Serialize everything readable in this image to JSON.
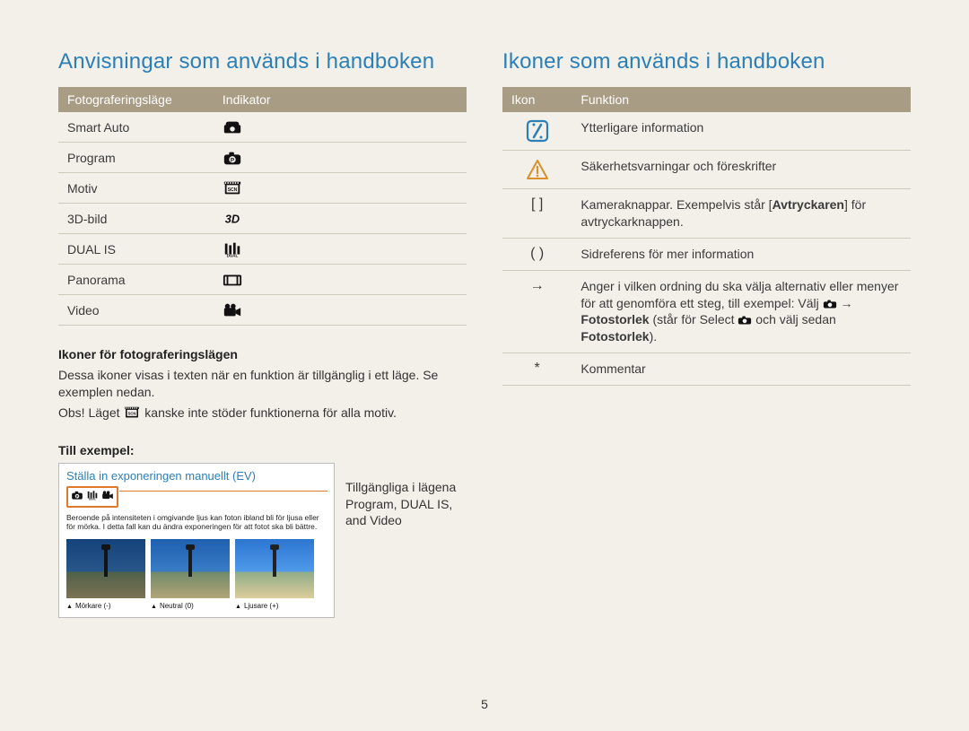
{
  "left": {
    "heading": "Anvisningar som används i handboken",
    "table": {
      "headers": [
        "Fotograferingsläge",
        "Indikator"
      ],
      "rows": [
        {
          "mode": "Smart Auto",
          "icon": "smart-auto"
        },
        {
          "mode": "Program",
          "icon": "program"
        },
        {
          "mode": "Motiv",
          "icon": "scene"
        },
        {
          "mode": "3D-bild",
          "icon": "3d"
        },
        {
          "mode": "DUAL IS",
          "icon": "dual-is"
        },
        {
          "mode": "Panorama",
          "icon": "panorama"
        },
        {
          "mode": "Video",
          "icon": "video"
        }
      ]
    },
    "sub_heading": "Ikoner för fotograferingslägen",
    "sub_text1": "Dessa ikoner visas i texten när en funktion är tillgänglig i ett läge. Se exemplen nedan.",
    "sub_text2_before": "Obs! Läget ",
    "sub_text2_after": " kanske inte stöder funktionerna för alla motiv.",
    "example_heading": "Till exempel:",
    "example": {
      "title": "Ställa in exponeringen manuellt (EV)",
      "desc": "Beroende på intensiteten i omgivande ljus kan foton ibland bli för ljusa eller för mörka. I detta fall kan du ändra exponeringen för att fotot ska bli bättre.",
      "thumbs": [
        {
          "label": "Mörkare (-)",
          "variant": "dark"
        },
        {
          "label": "Neutral (0)",
          "variant": ""
        },
        {
          "label": "Ljusare (+)",
          "variant": "light"
        }
      ]
    },
    "example_side": "Tillgängliga i lägena Program, DUAL IS, and Video"
  },
  "right": {
    "heading": "Ikoner som används i handboken",
    "table": {
      "headers": [
        "Ikon",
        "Funktion"
      ],
      "rows": [
        {
          "icon_type": "info",
          "text": "Ytterligare information"
        },
        {
          "icon_type": "warn",
          "text": "Säkerhetsvarningar och föreskrifter"
        },
        {
          "icon_type": "brackets",
          "icon_text": "[  ]",
          "text_pre": "Kameraknappar. Exempelvis står [",
          "text_bold": "Avtryckaren",
          "text_post": "] för avtryckarknappen."
        },
        {
          "icon_type": "parens",
          "icon_text": "(  )",
          "text": "Sidreferens för mer information"
        },
        {
          "icon_type": "arrow",
          "icon_text": "→",
          "text_lines_a": "Anger i vilken ordning du ska välja alternativ eller menyer för att genomföra ett steg, till exempel: Välj ",
          "text_lines_b": " → ",
          "bold1": "Fotostorlek",
          "mid": " (står för Select ",
          "post1": " och välj sedan ",
          "bold2": "Fotostorlek",
          "tail": ")."
        },
        {
          "icon_type": "star",
          "icon_text": "*",
          "text": "Kommentar"
        }
      ]
    }
  },
  "page_number": "5"
}
